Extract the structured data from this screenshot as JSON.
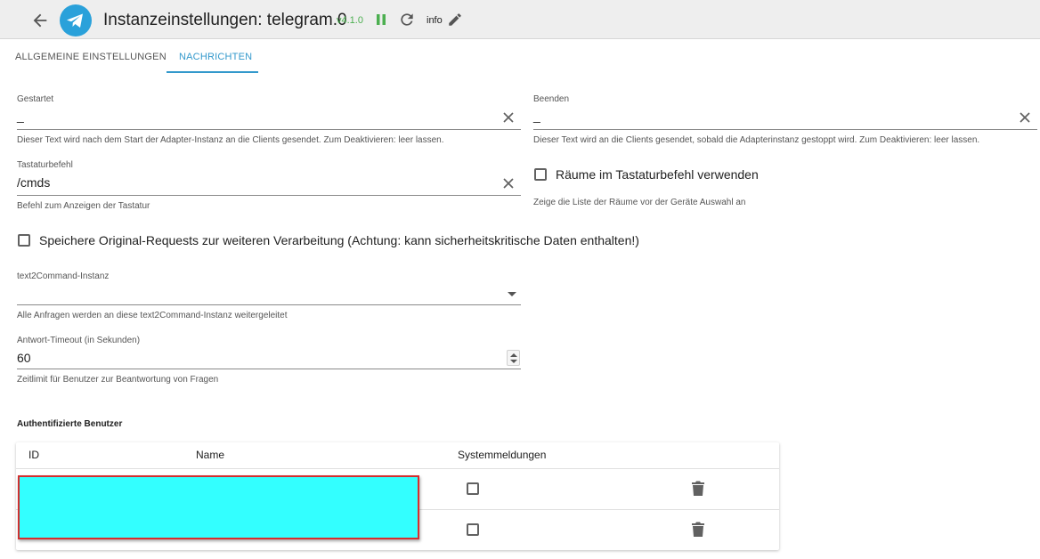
{
  "header": {
    "back_icon": "arrow-left-icon",
    "logo_icon": "telegram-logo-icon",
    "title": "Instanzeinstellungen: telegram.0",
    "version": "v4.1.0",
    "pause_icon": "pause-icon",
    "reload_icon": "reload-icon",
    "info_label": "info",
    "edit_icon": "pencil-icon",
    "version_color": "#4caf50",
    "accent_color": "#3399cc"
  },
  "tabs": [
    {
      "label": "ALLGEMEINE EINSTELLUNGEN",
      "active": false
    },
    {
      "label": "NACHRICHTEN",
      "active": true
    }
  ],
  "fields": {
    "started": {
      "label": "Gestartet",
      "value": "_",
      "helper": "Dieser Text wird nach dem Start der Adapter-Instanz an die Clients gesendet. Zum Deaktivieren: leer lassen."
    },
    "stopped": {
      "label": "Beenden",
      "value": "_",
      "helper": "Dieser Text wird an die Clients gesendet, sobald die Adapterinstanz gestoppt wird. Zum Deaktivieren: leer lassen."
    },
    "keyboard": {
      "label": "Tastaturbefehl",
      "value": "/cmds",
      "helper": "Befehl zum Anzeigen der Tastatur"
    },
    "rooms_checkbox": {
      "label": "Räume im Tastaturbefehl verwenden",
      "checked": false,
      "helper": "Zeige die Liste der Räume vor der Geräte Auswahl an"
    },
    "save_raw_checkbox": {
      "label": "Speichere Original-Requests zur weiteren Verarbeitung (Achtung: kann sicherheitskritische Daten enthalten!)",
      "checked": false
    },
    "text2command": {
      "label": "text2Command-Instanz",
      "value": "",
      "helper": "Alle Anfragen werden an diese text2Command-Instanz weitergeleitet"
    },
    "timeout": {
      "label": "Antwort-Timeout (in Sekunden)",
      "value": "60",
      "helper": "Zeitlimit für Benutzer zur Beantwortung von Fragen"
    }
  },
  "users_table": {
    "title": "Authentifizierte Benutzer",
    "columns": [
      "ID",
      "Name",
      "Systemmeldungen"
    ],
    "rows": [
      {
        "system_messages": false,
        "delete_icon": "trash-icon"
      },
      {
        "system_messages": false,
        "delete_icon": "trash-icon"
      }
    ]
  }
}
